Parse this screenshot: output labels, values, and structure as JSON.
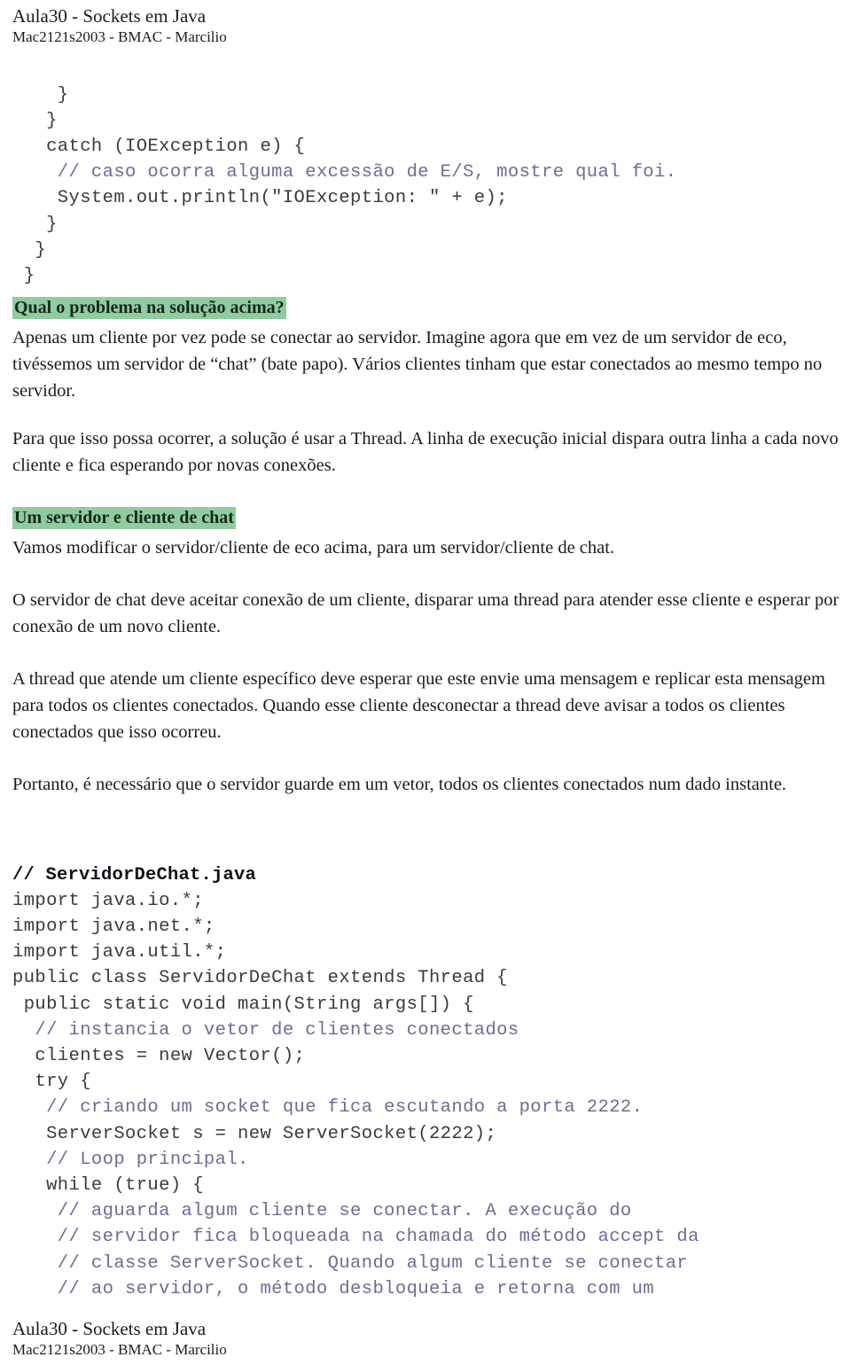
{
  "document": {
    "title": "Aula30 - Sockets em Java",
    "subtitle": "Mac2121s2003 - BMAC - Marcilio"
  },
  "header": {
    "title": "Aula30 - Sockets em Java",
    "subtitle": "Mac2121s2003 - BMAC - Marcilio"
  },
  "footer": {
    "title": "Aula30 - Sockets em Java",
    "subtitle": "Mac2121s2003 - BMAC - Marcilio"
  },
  "code_top": {
    "lines": [
      "    }",
      "   }",
      "   catch (IOException e) {",
      "    // caso ocorra alguma excessão de E/S, mostre qual foi.",
      "    System.out.println(\"IOException: \" + e);",
      "   }",
      "  }",
      " }"
    ],
    "comment_lines": [
      3
    ],
    "comment_color": "#6d6d92",
    "code_color": "#3a3a3f"
  },
  "section_problema": {
    "heading": "Qual o problema na solução acima?",
    "heading_highlight": "#8fcc9f",
    "paragraph": "Apenas um cliente por vez pode se conectar ao servidor. Imagine agora que em vez de um servidor de eco, tivéssemos um servidor de “chat” (bate papo). Vários clientes tinham que estar conectados ao mesmo tempo no servidor."
  },
  "section_thread": {
    "paragraph": "Para que isso possa ocorrer, a solução é usar a Thread. A linha de execução inicial dispara outra linha a cada novo cliente e fica esperando por novas conexões."
  },
  "section_chat": {
    "heading": "Um servidor e cliente de chat",
    "heading_highlight": "#8fcc9f",
    "paragraph_1": "Vamos modificar o servidor/cliente de eco acima, para um servidor/cliente de chat.",
    "paragraph_2": "O servidor de chat deve aceitar conexão de um cliente, disparar uma thread para atender esse cliente e esperar por conexão de um novo cliente.",
    "paragraph_3": "A thread que atende um cliente específico deve esperar que este envie uma mensagem e replicar esta mensagem para todos os clientes conectados. Quando esse cliente desconectar a thread deve avisar a todos os clientes conectados que isso ocorreu.",
    "paragraph_4": "Portanto, é necessário que o servidor guarde em um vetor, todos os clientes conectados num dado instante."
  },
  "code_main": {
    "file_comment": "// ServidorDeChat.java",
    "lines": [
      "import java.io.*;",
      "import java.net.*;",
      "import java.util.*;",
      "public class ServidorDeChat extends Thread {",
      " public static void main(String args[]) {",
      "  // instancia o vetor de clientes conectados",
      "  clientes = new Vector();",
      "  try {",
      "   // criando um socket que fica escutando a porta 2222.",
      "   ServerSocket s = new ServerSocket(2222);",
      "   // Loop principal.",
      "   while (true) {",
      "    // aguarda algum cliente se conectar. A execução do",
      "    // servidor fica bloqueada na chamada do método accept da",
      "    // classe ServerSocket. Quando algum cliente se conectar",
      "    // ao servidor, o método desbloqueia e retorna com um"
    ]
  }
}
